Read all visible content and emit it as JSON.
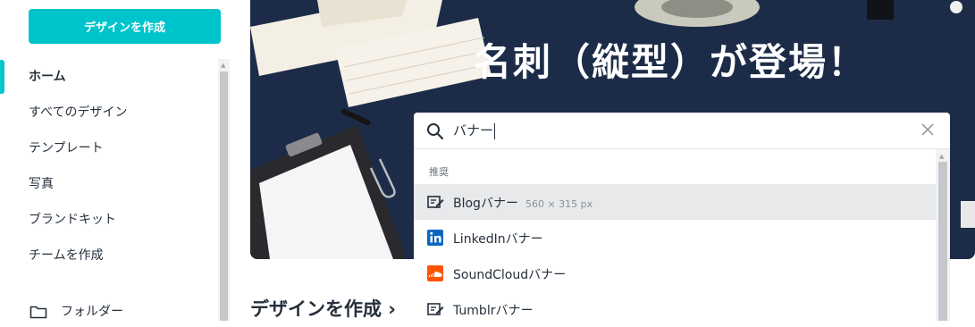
{
  "sidebar": {
    "create_button": "デザインを作成",
    "items": [
      {
        "label": "ホーム"
      },
      {
        "label": "すべてのデザイン"
      },
      {
        "label": "テンプレート"
      },
      {
        "label": "写真"
      },
      {
        "label": "ブランドキット"
      },
      {
        "label": "チームを作成"
      },
      {
        "label": "フォルダー",
        "icon": "folder-icon"
      }
    ]
  },
  "hero": {
    "title": "名刺（縦型）が登場！"
  },
  "section": {
    "title": "デザインを作成 ›"
  },
  "search": {
    "value": "バナー",
    "icon": "search-icon",
    "clear_icon": "close-icon"
  },
  "suggestions": {
    "heading": "推奨",
    "items": [
      {
        "label": "Blogバナー",
        "size": "560 × 315 px",
        "icon": "edit-icon"
      },
      {
        "label": "LinkedInバナー",
        "icon": "linkedin-icon"
      },
      {
        "label": "SoundCloudバナー",
        "icon": "soundcloud-icon"
      },
      {
        "label": "Tumblrバナー",
        "icon": "edit-icon"
      }
    ]
  },
  "colors": {
    "accent": "#00c4cc",
    "hero_bg": "#1c2c48",
    "highlight": "#e8e9eb",
    "linkedin": "#0a66c2",
    "soundcloud": "#ff5500"
  }
}
